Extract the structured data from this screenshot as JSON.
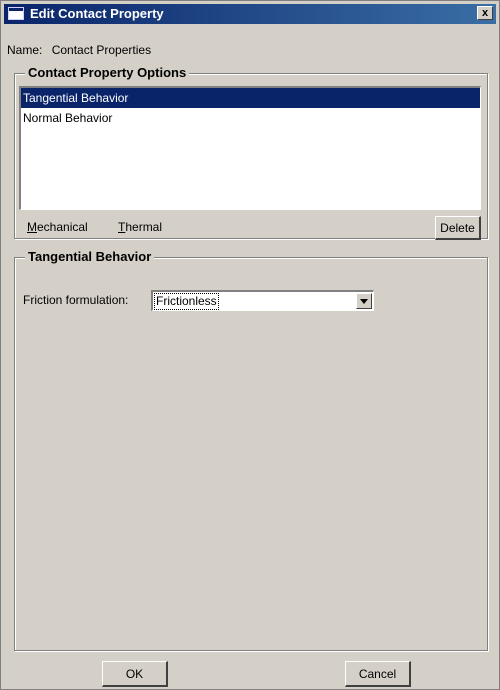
{
  "window": {
    "title": "Edit Contact Property",
    "close_label": "x"
  },
  "name_row": {
    "label": "Name:",
    "value": "Contact Properties"
  },
  "options_group": {
    "title": "Contact Property Options",
    "items": [
      {
        "label": "Tangential Behavior",
        "selected": true
      },
      {
        "label": "Normal Behavior",
        "selected": false
      }
    ],
    "menu": {
      "mechanical_mnemonic": "M",
      "mechanical_rest": "echanical",
      "thermal_mnemonic": "T",
      "thermal_rest": "hermal"
    },
    "delete_label": "Delete"
  },
  "behavior_group": {
    "title": "Tangential Behavior",
    "friction_label": "Friction formulation:",
    "friction_value": "Frictionless"
  },
  "buttons": {
    "ok_label": "OK",
    "cancel_label": "Cancel"
  },
  "colors": {
    "titlebar": "#0a246a",
    "selection": "#0a246a",
    "face": "#d4d0c8"
  }
}
